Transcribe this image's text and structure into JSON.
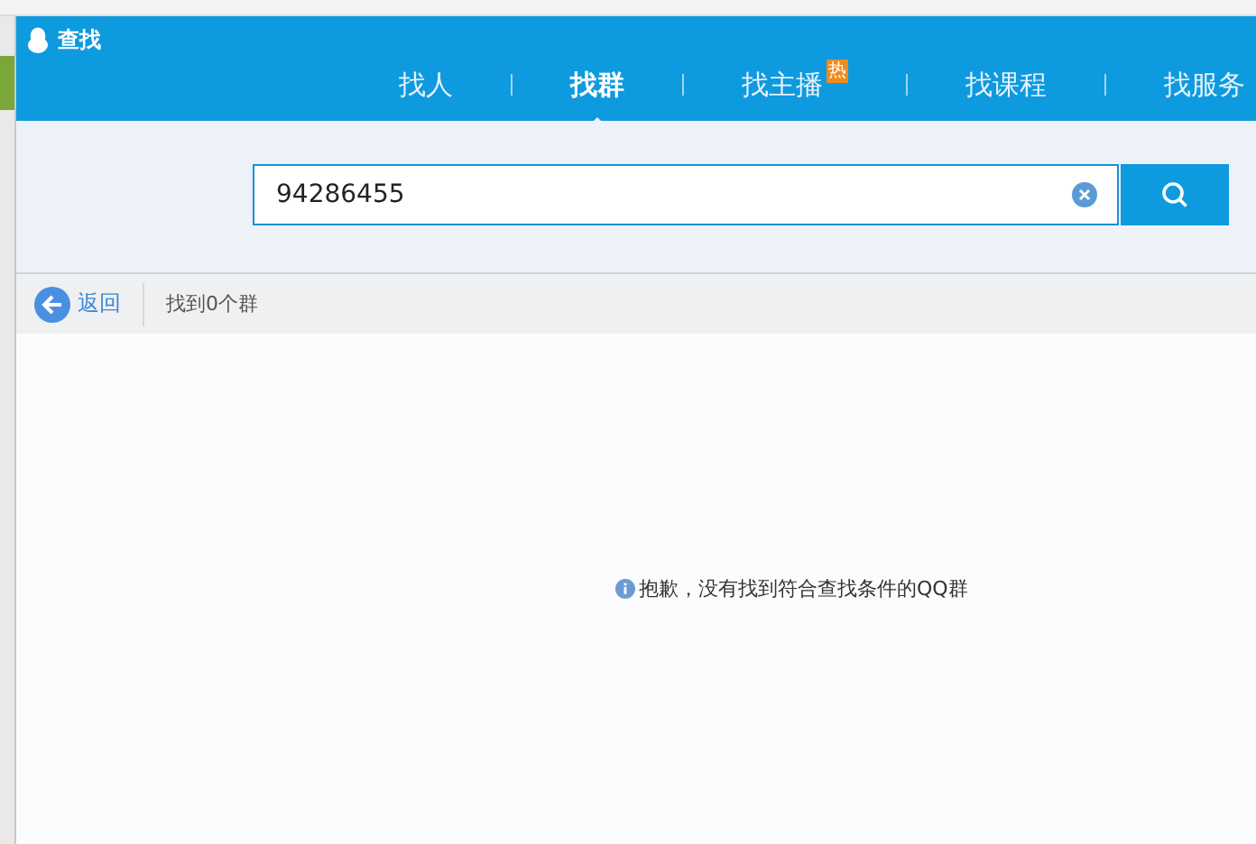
{
  "window": {
    "title": "查找"
  },
  "tabs": [
    {
      "label": "找人",
      "selected": false
    },
    {
      "label": "找群",
      "selected": true
    },
    {
      "label": "找主播",
      "selected": false,
      "badge": "热"
    },
    {
      "label": "找课程",
      "selected": false
    },
    {
      "label": "找服务",
      "selected": false
    }
  ],
  "search": {
    "value": "94286455"
  },
  "toolbar": {
    "back": "返回",
    "result_count": "找到0个群"
  },
  "message": "抱歉，没有找到符合查找条件的QQ群"
}
